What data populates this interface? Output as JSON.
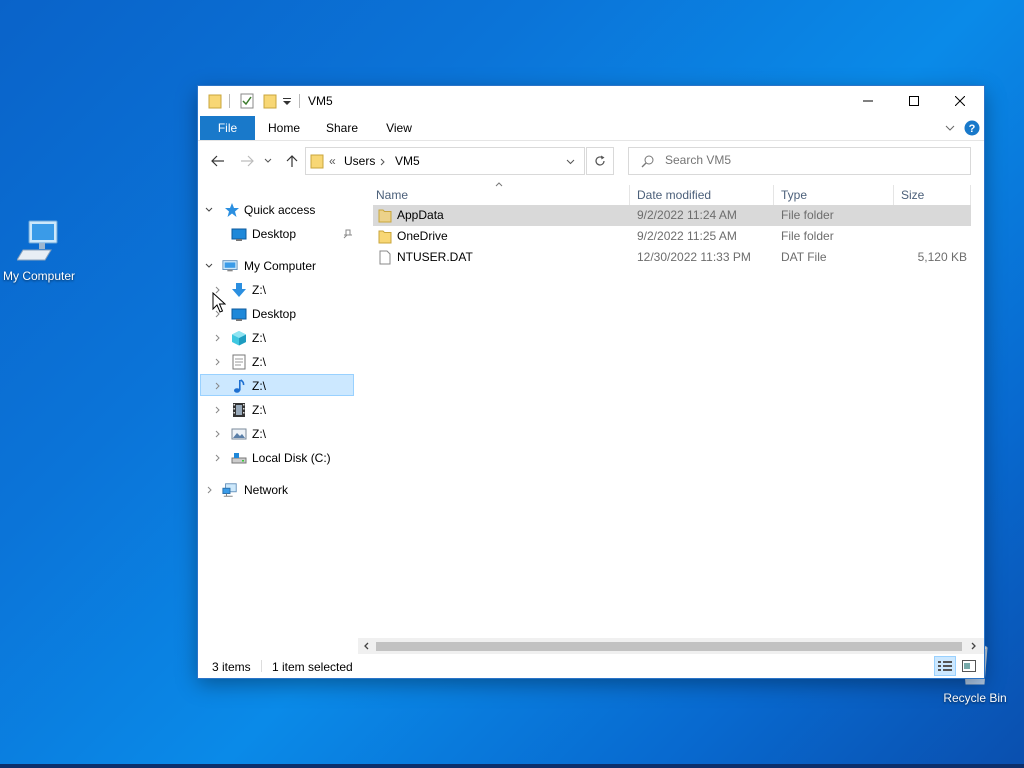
{
  "desktop": {
    "icons": [
      {
        "label": "My Computer"
      },
      {
        "label": "Recycle Bin"
      }
    ]
  },
  "window": {
    "title": "VM5",
    "ribbon_tabs": [
      "File",
      "Home",
      "Share",
      "View"
    ],
    "address": {
      "crumbs": [
        "Users",
        "VM5"
      ],
      "overflow": "«"
    },
    "search_placeholder": "Search VM5",
    "nav_pane": {
      "quick_access": "Quick access",
      "qa_desktop": "Desktop",
      "my_computer": "My Computer",
      "items": [
        {
          "label": "Z:\\",
          "icon": "download-arrow-icon",
          "selected": true
        },
        {
          "label": "Desktop",
          "icon": "desktop-icon"
        },
        {
          "label": "Z:\\",
          "icon": "3d-objects-icon"
        },
        {
          "label": "Z:\\",
          "icon": "documents-icon"
        },
        {
          "label": "Z:\\",
          "icon": "music-note-icon"
        },
        {
          "label": "Z:\\",
          "icon": "video-film-icon"
        },
        {
          "label": "Z:\\",
          "icon": "pictures-icon"
        },
        {
          "label": "Local Disk (C:)",
          "icon": "local-disk-icon"
        }
      ],
      "network": "Network"
    },
    "columns": [
      "Name",
      "Date modified",
      "Type",
      "Size"
    ],
    "files": [
      {
        "name": "AppData",
        "date": "9/2/2022 11:24 AM",
        "type": "File folder",
        "size": "",
        "icon": "folder-icon",
        "selected": true
      },
      {
        "name": "OneDrive",
        "date": "9/2/2022 11:25 AM",
        "type": "File folder",
        "size": "",
        "icon": "folder-icon"
      },
      {
        "name": "NTUSER.DAT",
        "date": "12/30/2022 11:33 PM",
        "type": "DAT File",
        "size": "5,120 KB",
        "icon": "file-icon"
      }
    ],
    "status": {
      "count": "3 items",
      "selection": "1 item selected"
    }
  },
  "colors": {
    "accent": "#1979ca",
    "selection": "#cce8ff",
    "row_selected": "#d9d9d9",
    "folder": "#f8d775"
  }
}
